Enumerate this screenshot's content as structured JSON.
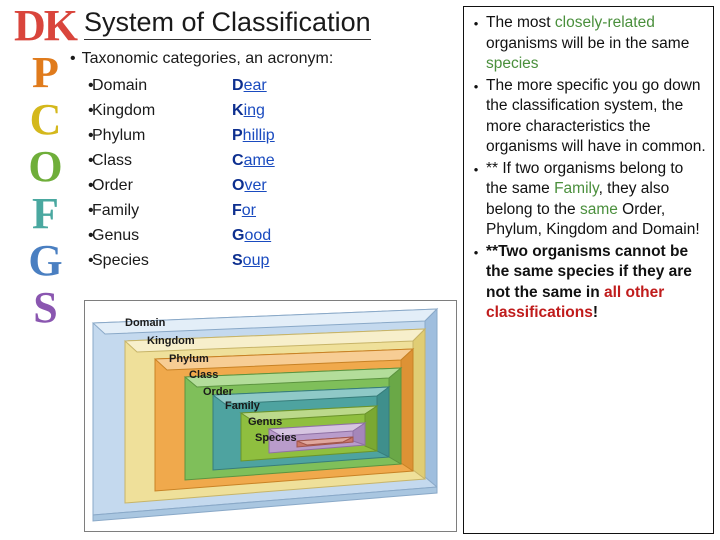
{
  "title": "System of Classification",
  "acronym_letters": [
    {
      "text": "DK",
      "color": "#d9453c",
      "pair": true
    },
    {
      "text": "P",
      "color": "#e07b1c"
    },
    {
      "text": "C",
      "color": "#d4b81c"
    },
    {
      "text": "O",
      "color": "#6fae3a"
    },
    {
      "text": "F",
      "color": "#4aa8a0"
    },
    {
      "text": "G",
      "color": "#4a7fc1"
    },
    {
      "text": "S",
      "color": "#8a56b0"
    }
  ],
  "lead_text": "Taxonomic categories, an acronym:",
  "categories": [
    {
      "rank": "Domain",
      "mnemonic_first": "D",
      "mnemonic_rest": "ear"
    },
    {
      "rank": "Kingdom",
      "mnemonic_first": "K",
      "mnemonic_rest": "ing"
    },
    {
      "rank": "Phylum",
      "mnemonic_first": "P",
      "mnemonic_rest": "hillip"
    },
    {
      "rank": "Class",
      "mnemonic_first": "C",
      "mnemonic_rest": "ame"
    },
    {
      "rank": "Order",
      "mnemonic_first": "O",
      "mnemonic_rest": "ver"
    },
    {
      "rank": "Family",
      "mnemonic_first": "F",
      "mnemonic_rest": "or"
    },
    {
      "rank": "Genus",
      "mnemonic_first": "G",
      "mnemonic_rest": "ood"
    },
    {
      "rank": "Species",
      "mnemonic_first": "S",
      "mnemonic_rest": "oup"
    }
  ],
  "bullet_char": "•",
  "notes": [
    {
      "parts": [
        {
          "t": "The most ",
          "style": "plain"
        },
        {
          "t": "closely-related",
          "style": "green"
        },
        {
          "t": " organisms will be in the same ",
          "style": "plain"
        },
        {
          "t": "species",
          "style": "green"
        }
      ]
    },
    {
      "parts": [
        {
          "t": "The more specific you go down the classification system, the more characteristics the organisms will have in common.",
          "style": "plain"
        }
      ]
    },
    {
      "parts": [
        {
          "t": "** If two organisms belong to the same ",
          "style": "plain"
        },
        {
          "t": "Family",
          "style": "green"
        },
        {
          "t": ", they also belong to the ",
          "style": "plain"
        },
        {
          "t": "same",
          "style": "green"
        },
        {
          "t": " Order, Phylum, Kingdom and Domain!",
          "style": "plain"
        }
      ]
    },
    {
      "parts": [
        {
          "t": "**Two organisms cannot be the same species if they are not the same in ",
          "style": "bold"
        },
        {
          "t": "all other classifications",
          "style": "bold-red"
        },
        {
          "t": "!",
          "style": "bold"
        }
      ]
    }
  ],
  "diagram": {
    "name": "classification-pyramid",
    "levels": [
      {
        "label": "Domain",
        "color": "#c4d9ee"
      },
      {
        "label": "Kingdom",
        "color": "#efe09a"
      },
      {
        "label": "Phylum",
        "color": "#f0a94c"
      },
      {
        "label": "Class",
        "color": "#7fbf5a"
      },
      {
        "label": "Order",
        "color": "#4ea3a0"
      },
      {
        "label": "Family",
        "color": "#8fbf3f"
      },
      {
        "label": "Genus",
        "color": "#b99ccb"
      },
      {
        "label": "Species",
        "color": "#c9776b"
      }
    ]
  }
}
